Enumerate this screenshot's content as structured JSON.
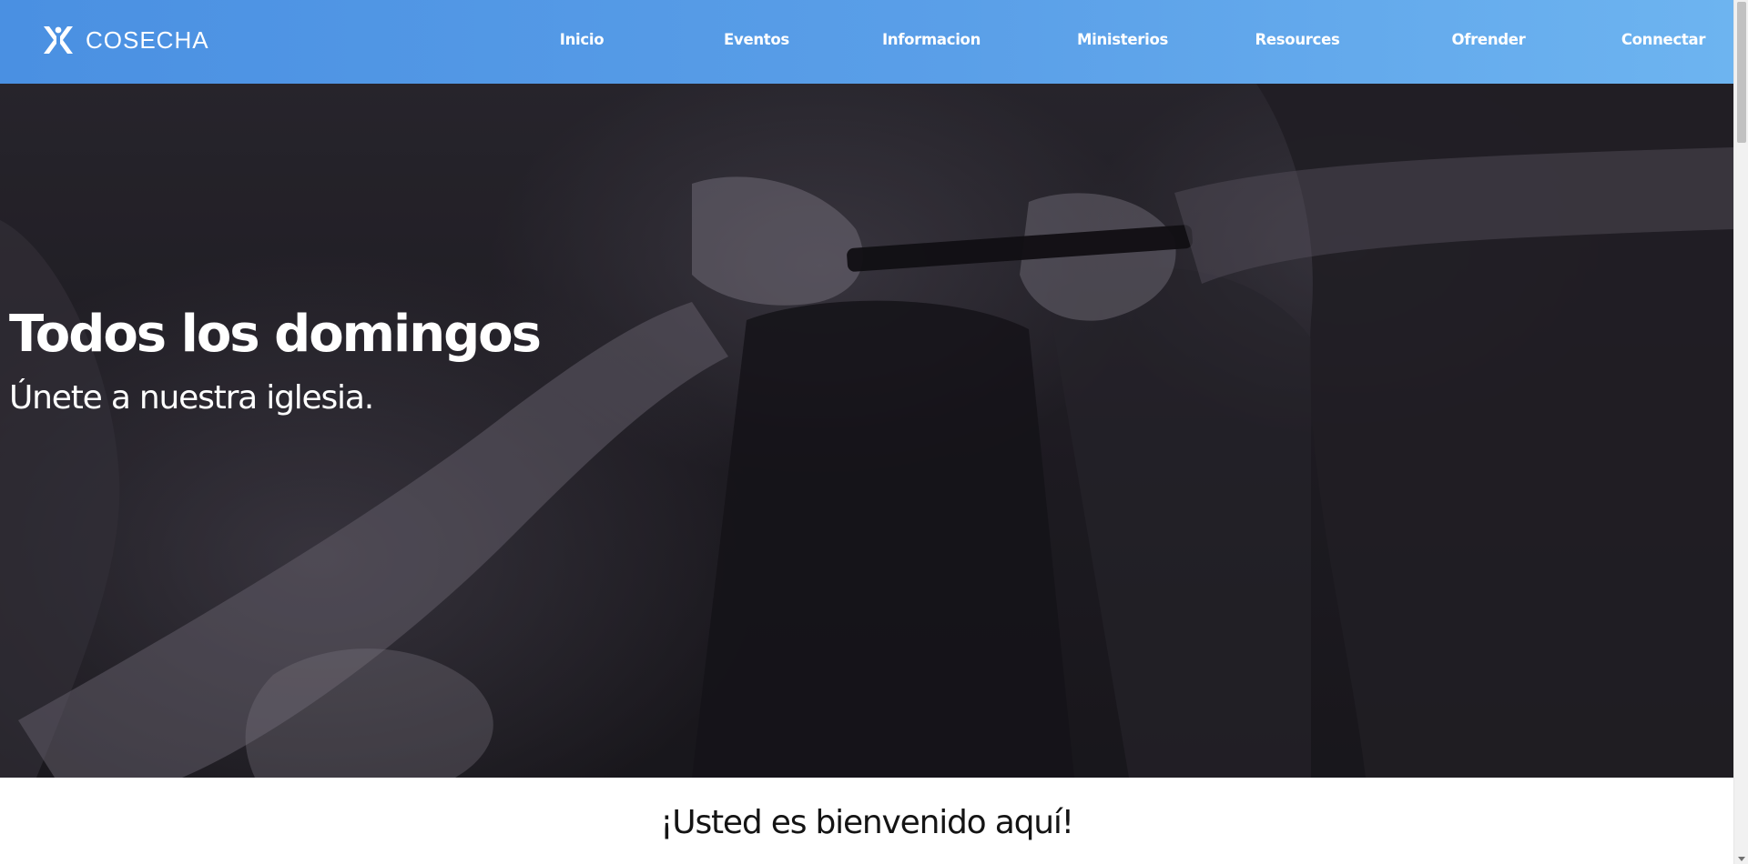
{
  "brand": {
    "name": "COSECHA",
    "color": "#ffffff"
  },
  "nav": {
    "background_start": "#4a90e2",
    "background_end": "#6db4f0",
    "items": [
      {
        "label": "Inicio"
      },
      {
        "label": "Eventos"
      },
      {
        "label": "Informacion"
      },
      {
        "label": "Ministerios"
      },
      {
        "label": "Resources"
      },
      {
        "label": "Ofrender"
      },
      {
        "label": "Connectar"
      }
    ]
  },
  "hero": {
    "title": "Todos los domingos",
    "subtitle": "Únete a nuestra iglesia.",
    "image": "people-hands-photo",
    "overlay_color": "#1f1d23"
  },
  "welcome": {
    "title": "¡Usted es bienvenido aquí!"
  }
}
